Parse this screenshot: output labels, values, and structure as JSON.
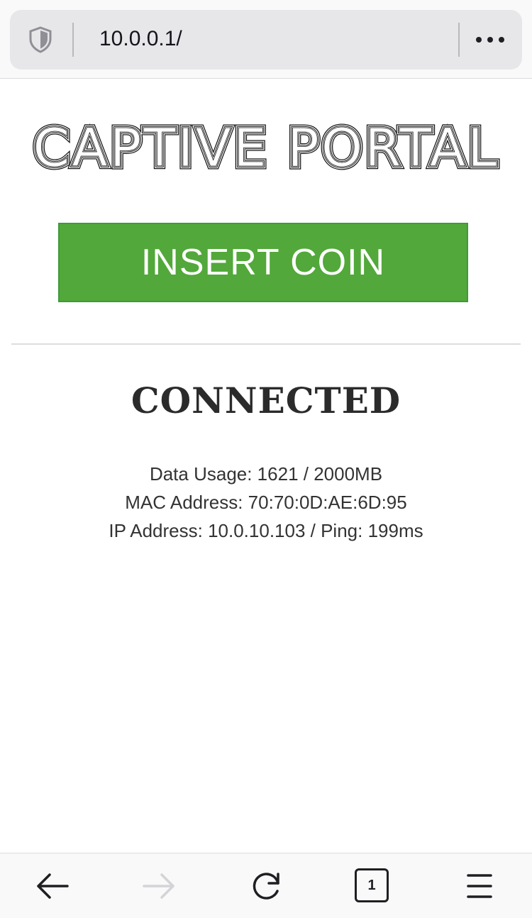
{
  "browser": {
    "url": "10.0.0.1/",
    "tab_count": "1"
  },
  "page": {
    "title": "CAPTIVE PORTAL",
    "insert_coin_label": "INSERT COIN",
    "status": "CONNECTED",
    "info": {
      "data_usage": "Data Usage: 1621 / 2000MB",
      "mac_address": "MAC Address: 70:70:0D:AE:6D:95",
      "ip_ping": "IP Address: 10.0.10.103 / Ping: 199ms"
    }
  },
  "colors": {
    "button_green": "#52a83a",
    "heading_dark": "#2b2b2b"
  },
  "icons": [
    "shield-icon",
    "more-icon",
    "back-arrow-icon",
    "forward-arrow-icon",
    "reload-icon",
    "tabs-icon",
    "menu-icon"
  ]
}
